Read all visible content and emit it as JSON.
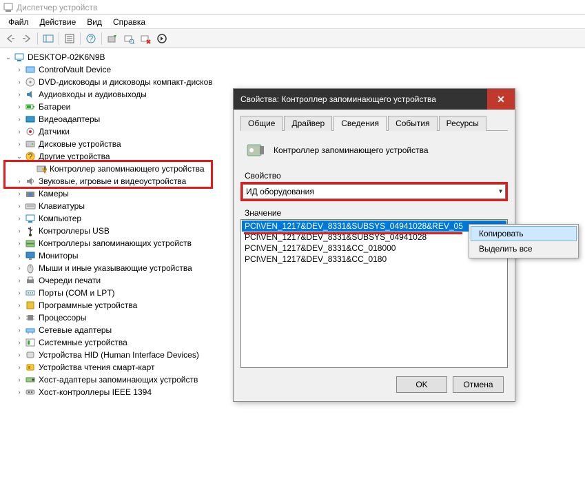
{
  "window": {
    "title": "Диспетчер устройств"
  },
  "menu": {
    "file": "Файл",
    "action": "Действие",
    "view": "Вид",
    "help": "Справка"
  },
  "tree": {
    "root": "DESKTOP-02K6N9B",
    "items": [
      "ControlVault Device",
      "DVD-дисководы и дисководы компакт-дисков",
      "Аудиовходы и аудиовыходы",
      "Батареи",
      "Видеоадаптеры",
      "Датчики",
      "Дисковые устройства",
      "Другие устройства",
      "Контроллер запоминающего устройства",
      "Звуковые, игровые и видеоустройства",
      "Камеры",
      "Клавиатуры",
      "Компьютер",
      "Контроллеры USB",
      "Контроллеры запоминающих устройств",
      "Мониторы",
      "Мыши и иные указывающие устройства",
      "Очереди печати",
      "Порты (COM и LPT)",
      "Программные устройства",
      "Процессоры",
      "Сетевые адаптеры",
      "Системные устройства",
      "Устройства HID (Human Interface Devices)",
      "Устройства чтения смарт-карт",
      "Хост-адаптеры запоминающих устройств",
      "Хост-контроллеры IEEE 1394"
    ]
  },
  "dialog": {
    "title": "Свойства: Контроллер запоминающего устройства",
    "tabs": {
      "general": "Общие",
      "driver": "Драйвер",
      "details": "Сведения",
      "events": "События",
      "resources": "Ресурсы"
    },
    "device_name": "Контроллер запоминающего устройства",
    "prop_label": "Свойство",
    "prop_selected": "ИД оборудования",
    "value_label": "Значение",
    "values": [
      "PCI\\VEN_1217&DEV_8331&SUBSYS_04941028&REV_05",
      "PCI\\VEN_1217&DEV_8331&SUBSYS_04941028",
      "PCI\\VEN_1217&DEV_8331&CC_018000",
      "PCI\\VEN_1217&DEV_8331&CC_0180"
    ],
    "ok": "OK",
    "cancel": "Отмена"
  },
  "context": {
    "copy": "Копировать",
    "selectall": "Выделить все"
  }
}
